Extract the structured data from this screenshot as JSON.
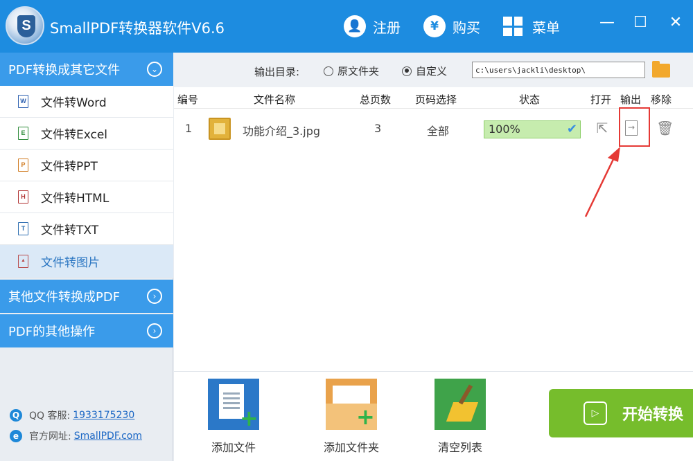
{
  "app": {
    "title": "SmallPDF转换器软件V6.6",
    "logo_letter": "S"
  },
  "titlebar": {
    "register_label": "注册",
    "buy_label": "购买",
    "menu_label": "菜单",
    "register_icon": "user-plus-icon",
    "buy_icon": "yen-icon",
    "menu_icon": "grid-icon",
    "minimize": "—",
    "maximize": "☐",
    "close": "✕",
    "accent_color": "#1d8ce0"
  },
  "sidebar": {
    "section1": "PDF转换成其它文件",
    "items": [
      {
        "label": "文件转Word",
        "icon_letter": "W",
        "color": "#2b5fb0"
      },
      {
        "label": "文件转Excel",
        "icon_letter": "E",
        "color": "#2e8b3a"
      },
      {
        "label": "文件转PPT",
        "icon_letter": "P",
        "color": "#d07a1f"
      },
      {
        "label": "文件转HTML",
        "icon_letter": "H",
        "color": "#b03030"
      },
      {
        "label": "文件转TXT",
        "icon_letter": "T",
        "color": "#2b6cb0"
      },
      {
        "label": "文件转图片",
        "icon_letter": "▲",
        "color": "#b84a4a"
      }
    ],
    "section2": "其他文件转换成PDF",
    "section3": "PDF的其他操作",
    "qq_label": "QQ 客服:",
    "qq_number": "1933175230",
    "site_label": "官方网址:",
    "site_url": "SmallPDF.com"
  },
  "output": {
    "label": "输出目录:",
    "option_original": "原文件夹",
    "option_custom": "自定义",
    "selected": "自定义",
    "path": "c:\\users\\jackli\\desktop\\"
  },
  "table": {
    "headers": [
      "编号",
      "文件名称",
      "总页数",
      "页码选择",
      "状态",
      "打开",
      "输出",
      "移除"
    ],
    "rows": [
      {
        "index": "1",
        "filename": "功能介绍_3.jpg",
        "pages": "3",
        "page_select": "全部",
        "status": "100%",
        "progress": 1.0
      }
    ]
  },
  "toolbar": {
    "add_file": "添加文件",
    "add_folder": "添加文件夹",
    "clear_list": "清空列表",
    "start": "开始转换"
  }
}
